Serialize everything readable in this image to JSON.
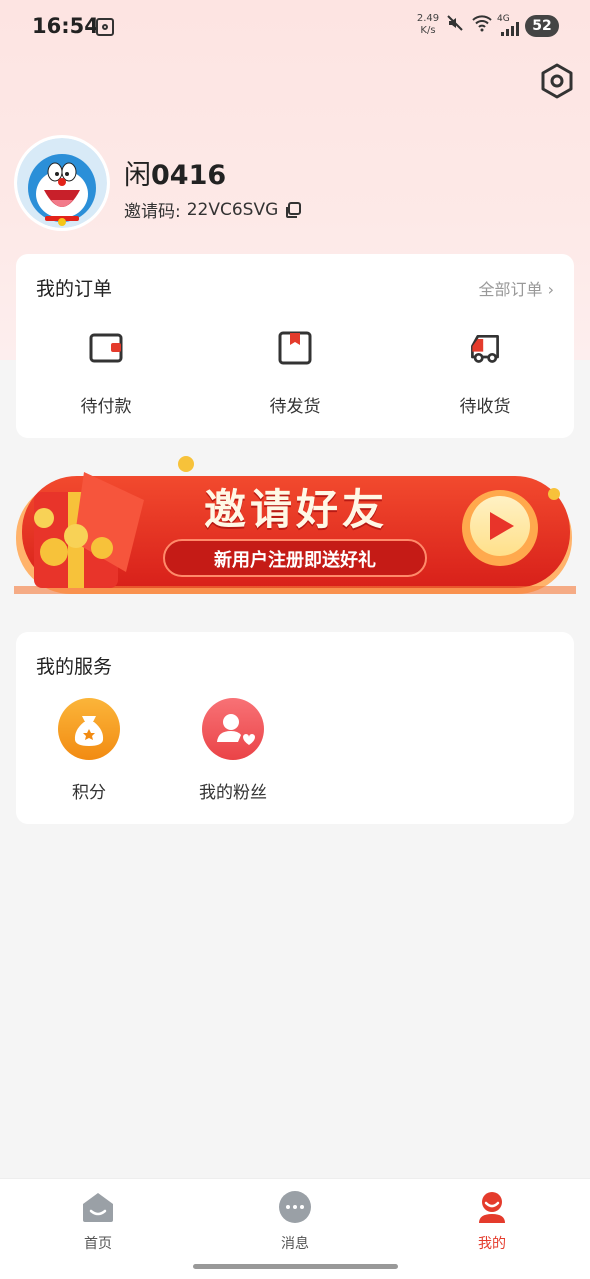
{
  "status_bar": {
    "time": "16:54",
    "net_speed_value": "2.49",
    "net_speed_unit": "K/s",
    "battery": "52",
    "signal_label": "4G"
  },
  "profile": {
    "name_prefix": "闲",
    "name_suffix": "0416",
    "invite_label": "邀请码:",
    "invite_code": "22VC6SVG"
  },
  "orders": {
    "title": "我的订单",
    "all_label": "全部订单",
    "items": [
      {
        "label": "待付款",
        "icon": "wallet-icon"
      },
      {
        "label": "待发货",
        "icon": "package-icon"
      },
      {
        "label": "待收货",
        "icon": "truck-icon"
      }
    ]
  },
  "banner": {
    "title": "邀请好友",
    "subtitle": "新用户注册即送好礼"
  },
  "services": {
    "title": "我的服务",
    "items": [
      {
        "label": "积分",
        "icon": "points-bag-icon",
        "color": "#f7a21c"
      },
      {
        "label": "我的粉丝",
        "icon": "fans-icon",
        "color": "#f0565b"
      }
    ]
  },
  "tabbar": {
    "items": [
      {
        "label": "首页",
        "icon": "home-icon",
        "active": false
      },
      {
        "label": "消息",
        "icon": "message-icon",
        "active": false
      },
      {
        "label": "我的",
        "icon": "profile-icon",
        "active": true
      }
    ],
    "accent": "#e43b2c"
  }
}
